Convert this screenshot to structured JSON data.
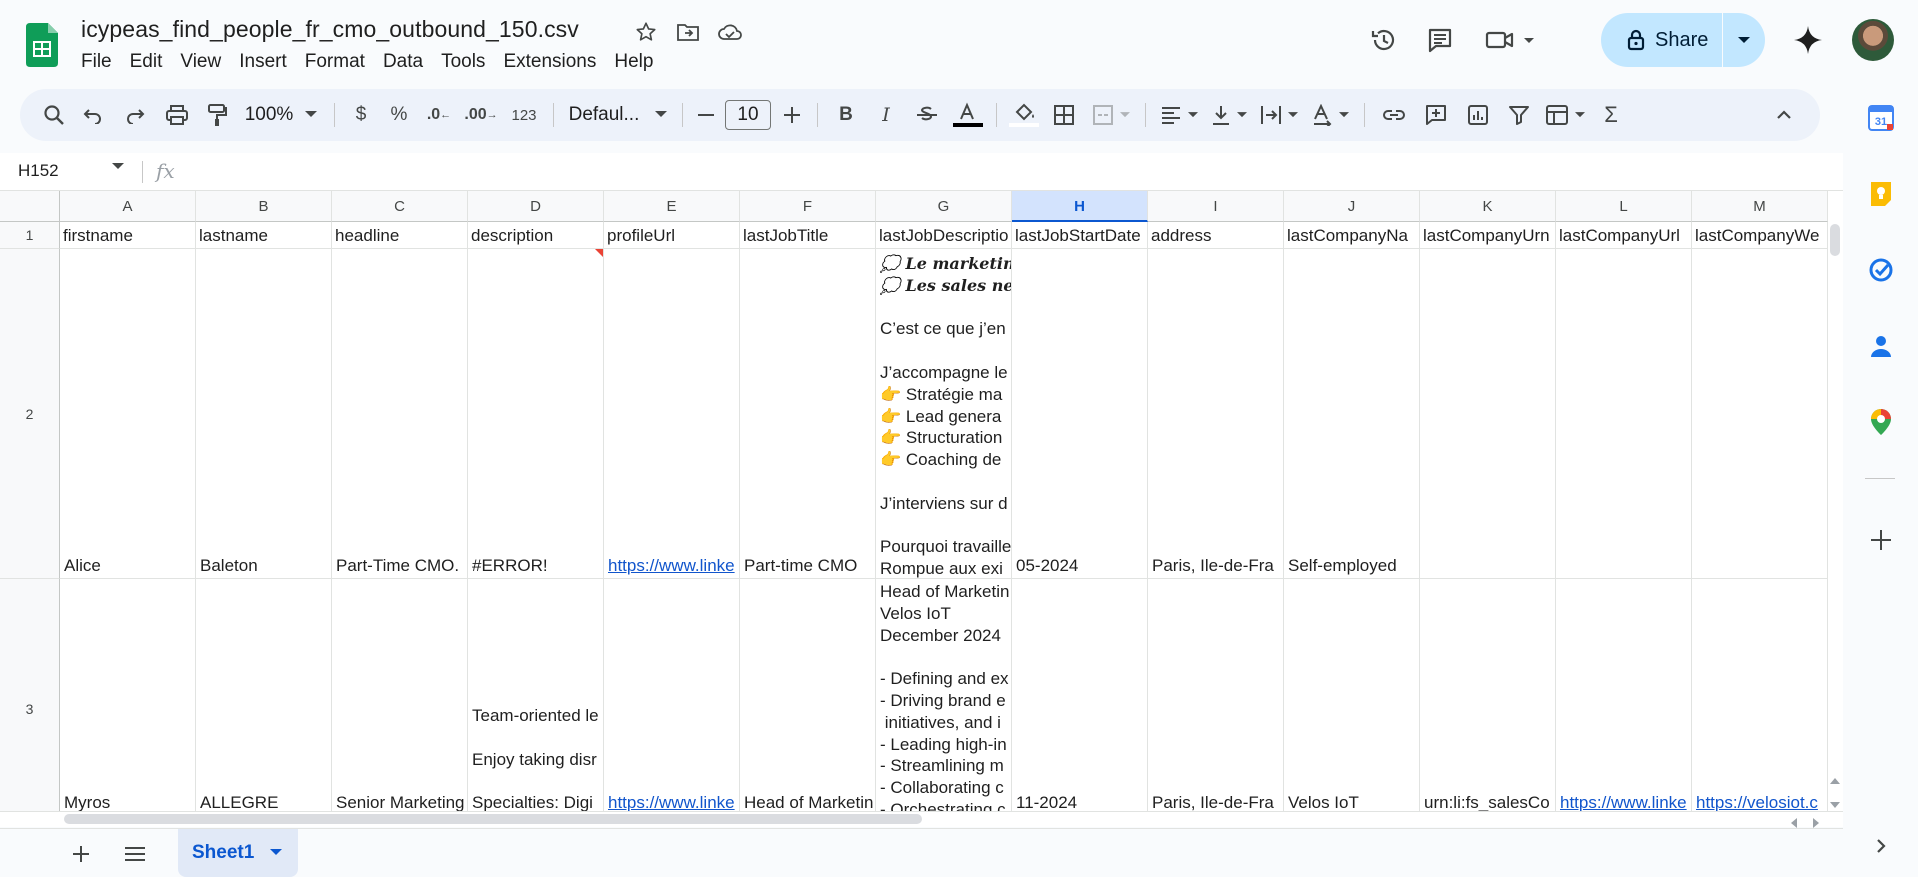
{
  "document": {
    "title": "icypeas_find_people_fr_cmo_outbound_150.csv"
  },
  "menu": [
    "File",
    "Edit",
    "View",
    "Insert",
    "Format",
    "Data",
    "Tools",
    "Extensions",
    "Help"
  ],
  "share_label": "Share",
  "toolbar": {
    "zoom": "100%",
    "currency": "$",
    "percent": "%",
    "decrease_decimal": ".0",
    "increase_decimal": ".00",
    "number_format": "123",
    "font": "Defaul...",
    "font_size": "10",
    "bold": "B",
    "italic": "I",
    "sigma": "Σ"
  },
  "formula_bar": {
    "name_box": "H152",
    "fx": "fx"
  },
  "grid": {
    "columns": [
      "A",
      "B",
      "C",
      "D",
      "E",
      "F",
      "G",
      "H",
      "I",
      "J",
      "K",
      "L",
      "M"
    ],
    "selected_column": "H",
    "rows": [
      "1",
      "2",
      "3"
    ],
    "header_row": [
      "firstname",
      "lastname",
      "headline",
      "description",
      "profileUrl",
      "lastJobTitle",
      "lastJobDescriptio",
      "lastJobStartDate",
      "address",
      "lastCompanyNa",
      "lastCompanyUrn",
      "lastCompanyUrl",
      "lastCompanyWe"
    ],
    "row2": {
      "firstname": "Alice",
      "lastname": "Baleton",
      "headline": "Part-Time CMO.",
      "description": "#ERROR!",
      "profileUrl": "https://www.linke",
      "lastJobTitle": "Part-time CMO",
      "jobdesc_line1": "💭 Le marketin",
      "jobdesc_line2": "💭 Les sales ne",
      "jobdesc_line3": "C’est ce que j’en",
      "jobdesc_line4": "J’accompagne le",
      "jobdesc_line5": "👉 Stratégie ma",
      "jobdesc_line6": "👉 Lead genera",
      "jobdesc_line7": "👉 Structuration",
      "jobdesc_line8": "👉 Coaching de",
      "jobdesc_line9": "J’interviens sur d",
      "jobdesc_line10": "Pourquoi travaille",
      "jobdesc_line11": "Rompue aux exi",
      "startDate": "05-2024",
      "address": "Paris, Ile-de-Fra",
      "company": "Self-employed"
    },
    "row3": {
      "firstname": "Myros",
      "lastname": "ALLEGRE",
      "headline": "Senior Marketing",
      "description_line1": "Team-oriented le",
      "description_line2": "Enjoy taking disr",
      "description_line3": "Specialties: Digi",
      "profileUrl": "https://www.linke",
      "lastJobTitle": "Head of Marketin",
      "jobdesc_line1": "Head of Marketin",
      "jobdesc_line2": "Velos IoT",
      "jobdesc_line3": "December 2024",
      "jobdesc_line4": "- Defining and ex",
      "jobdesc_line5": "- Driving brand e",
      "jobdesc_line6": " initiatives, and i",
      "jobdesc_line7": "- Leading high-in",
      "jobdesc_line8": "- Streamlining m",
      "jobdesc_line9": "- Collaborating c",
      "jobdesc_line10": "- Orchestrating c",
      "startDate": "11-2024",
      "address": "Paris, Ile-de-Fra",
      "company": "Velos IoT",
      "companyUrn": "urn:li:fs_salesCo",
      "companyUrl": "https://www.linke",
      "companyWebsite": "https://velosiot.c"
    }
  },
  "sheet_tab": "Sheet1",
  "colors": {
    "accent": "#0b57d0",
    "share_bg": "#c2e7ff",
    "toolbar_bg": "#edf2fa",
    "selected_col_bg": "#d3e3fd",
    "link": "#1155cc"
  }
}
